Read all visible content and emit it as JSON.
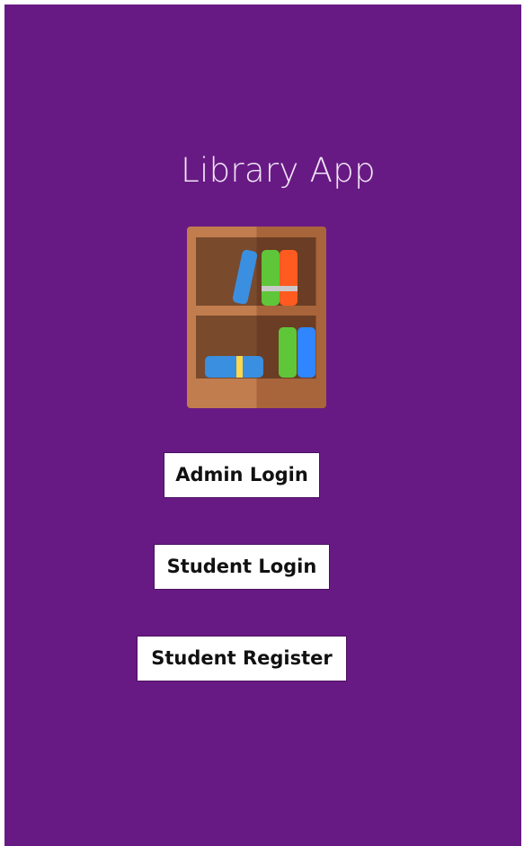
{
  "app": {
    "title": "Library App"
  },
  "logo": {
    "icon": "bookshelf-icon"
  },
  "buttons": {
    "admin_login": "Admin Login",
    "student_login": "Student Login",
    "student_register": "Student Register"
  },
  "colors": {
    "background": "#681a84",
    "title_text": "#f1e6f6",
    "button_bg": "#ffffff",
    "button_text": "#111111"
  }
}
